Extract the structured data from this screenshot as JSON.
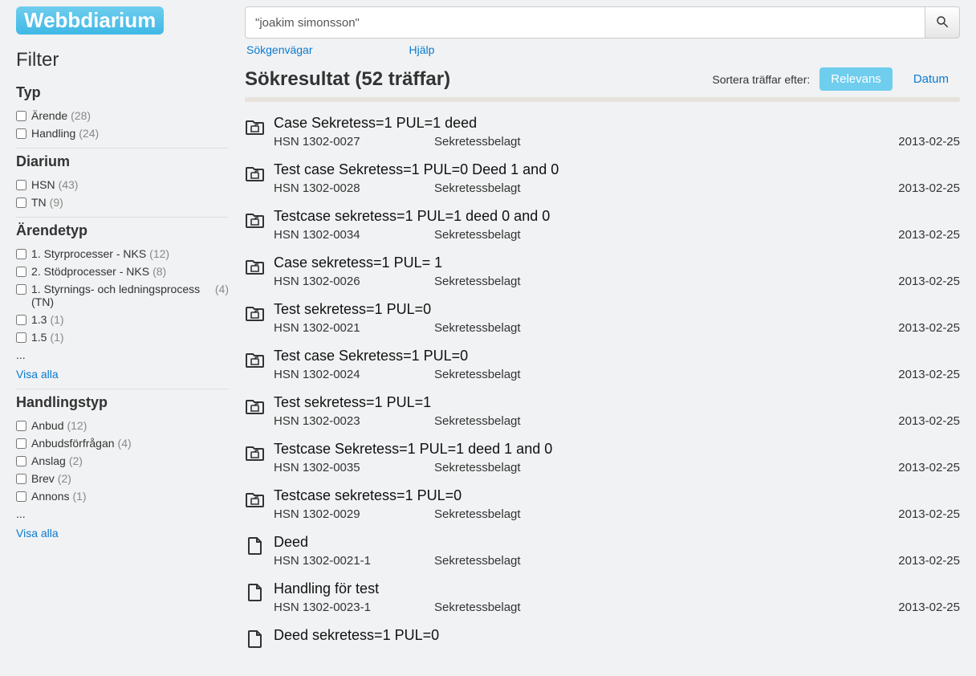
{
  "app": {
    "name": "Webbdiarium"
  },
  "search": {
    "value": "\"joakim simonsson\"",
    "links": {
      "shortcuts": "Sökgenvägar",
      "help": "Hjälp"
    }
  },
  "sidebar": {
    "title": "Filter",
    "show_all": "Visa alla",
    "ellipsis": "...",
    "groups": [
      {
        "key": "typ",
        "title": "Typ",
        "items": [
          {
            "label": "Ärende",
            "count": "(28)"
          },
          {
            "label": "Handling",
            "count": "(24)"
          }
        ]
      },
      {
        "key": "diarium",
        "title": "Diarium",
        "items": [
          {
            "label": "HSN",
            "count": "(43)"
          },
          {
            "label": "TN",
            "count": "(9)"
          }
        ]
      },
      {
        "key": "arendetyp",
        "title": "Ärendetyp",
        "more": true,
        "show_all": true,
        "items": [
          {
            "label": "1. Styrprocesser - NKS",
            "count": "(12)"
          },
          {
            "label": "2. Stödprocesser - NKS",
            "count": "(8)"
          },
          {
            "label": "1. Styrnings- och ledningsprocess (TN)",
            "count": "(4)"
          },
          {
            "label": "1.3",
            "count": "(1)"
          },
          {
            "label": "1.5",
            "count": "(1)"
          }
        ]
      },
      {
        "key": "handlingstyp",
        "title": "Handlingstyp",
        "more": true,
        "show_all": true,
        "items": [
          {
            "label": "Anbud",
            "count": "(12)"
          },
          {
            "label": "Anbudsförfrågan",
            "count": "(4)"
          },
          {
            "label": "Anslag",
            "count": "(2)"
          },
          {
            "label": "Brev",
            "count": "(2)"
          },
          {
            "label": "Annons",
            "count": "(1)"
          }
        ]
      }
    ]
  },
  "results": {
    "title": "Sökresultat (52 träffar)",
    "sort": {
      "label": "Sortera träffar efter:",
      "relevance": "Relevans",
      "date": "Datum",
      "active": "relevance"
    },
    "items": [
      {
        "icon": "case",
        "title": "Case Sekretess=1 PUL=1 deed",
        "id": "HSN 1302-0027",
        "status": "Sekretessbelagt",
        "date": "2013-02-25"
      },
      {
        "icon": "case",
        "title": "Test case Sekretess=1 PUL=0 Deed 1 and 0",
        "id": "HSN 1302-0028",
        "status": "Sekretessbelagt",
        "date": "2013-02-25"
      },
      {
        "icon": "case",
        "title": "Testcase sekretess=1 PUL=1 deed 0 and 0",
        "id": "HSN 1302-0034",
        "status": "Sekretessbelagt",
        "date": "2013-02-25"
      },
      {
        "icon": "case",
        "title": "Case sekretess=1 PUL= 1",
        "id": "HSN 1302-0026",
        "status": "Sekretessbelagt",
        "date": "2013-02-25"
      },
      {
        "icon": "case",
        "title": "Test sekretess=1 PUL=0",
        "id": "HSN 1302-0021",
        "status": "Sekretessbelagt",
        "date": "2013-02-25"
      },
      {
        "icon": "case",
        "title": "Test case Sekretess=1 PUL=0",
        "id": "HSN 1302-0024",
        "status": "Sekretessbelagt",
        "date": "2013-02-25"
      },
      {
        "icon": "case",
        "title": "Test sekretess=1 PUL=1",
        "id": "HSN 1302-0023",
        "status": "Sekretessbelagt",
        "date": "2013-02-25"
      },
      {
        "icon": "case",
        "title": "Testcase Sekretess=1 PUL=1 deed 1 and 0",
        "id": "HSN 1302-0035",
        "status": "Sekretessbelagt",
        "date": "2013-02-25"
      },
      {
        "icon": "case",
        "title": "Testcase sekretess=1 PUL=0",
        "id": "HSN 1302-0029",
        "status": "Sekretessbelagt",
        "date": "2013-02-25"
      },
      {
        "icon": "doc",
        "title": "Deed",
        "id": "HSN 1302-0021-1",
        "status": "Sekretessbelagt",
        "date": "2013-02-25"
      },
      {
        "icon": "doc",
        "title": "Handling för test",
        "id": "HSN 1302-0023-1",
        "status": "Sekretessbelagt",
        "date": "2013-02-25"
      },
      {
        "icon": "doc",
        "title": "Deed sekretess=1 PUL=0",
        "id": "",
        "status": "",
        "date": ""
      }
    ]
  }
}
